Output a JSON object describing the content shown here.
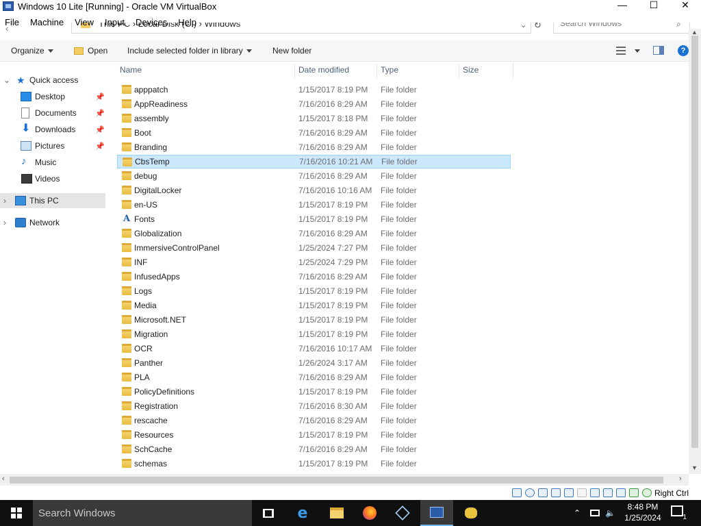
{
  "host_window": {
    "title": "Windows 10 Lite [Running] - Oracle VM VirtualBox",
    "minimize_glyph": "—",
    "maximize_glyph": "☐",
    "close_glyph": "✕"
  },
  "vbox_menu": [
    "File",
    "Machine",
    "View",
    "Input",
    "Devices",
    "Help"
  ],
  "address_bar": {
    "crumbs": "This PC  ›  Local Disk (C:)  ›  Windows",
    "search_placeholder": "Search Windows"
  },
  "toolbar": {
    "organize": "Organize",
    "open": "Open",
    "include_in_library": "Include selected folder in library",
    "new_folder": "New folder",
    "help_glyph": "?"
  },
  "nav": {
    "quick_access": "Quick access",
    "quick_items": [
      "Desktop",
      "Documents",
      "Downloads",
      "Pictures",
      "Music",
      "Videos"
    ],
    "this_pc": "This PC",
    "network": "Network"
  },
  "columns": [
    "Name",
    "Date modified",
    "Type",
    "Size"
  ],
  "files": [
    {
      "name": "apppatch",
      "date": "1/15/2017 8:19 PM",
      "type": "File folder",
      "icon": "folder-icon"
    },
    {
      "name": "AppReadiness",
      "date": "7/16/2016 8:29 AM",
      "type": "File folder",
      "icon": "folder-icon"
    },
    {
      "name": "assembly",
      "date": "1/15/2017 8:18 PM",
      "type": "File folder",
      "icon": "folder-icon"
    },
    {
      "name": "Boot",
      "date": "7/16/2016 8:29 AM",
      "type": "File folder",
      "icon": "folder-icon"
    },
    {
      "name": "Branding",
      "date": "7/16/2016 8:29 AM",
      "type": "File folder",
      "icon": "folder-icon"
    },
    {
      "name": "CbsTemp",
      "date": "7/16/2016 10:21 AM",
      "type": "File folder",
      "icon": "folder-icon",
      "selected": true
    },
    {
      "name": "debug",
      "date": "7/16/2016 8:29 AM",
      "type": "File folder",
      "icon": "folder-icon"
    },
    {
      "name": "DigitalLocker",
      "date": "7/16/2016 10:16 AM",
      "type": "File folder",
      "icon": "folder-icon"
    },
    {
      "name": "en-US",
      "date": "1/15/2017 8:19 PM",
      "type": "File folder",
      "icon": "folder-icon"
    },
    {
      "name": "Fonts",
      "date": "1/15/2017 8:19 PM",
      "type": "File folder",
      "icon": "font-folder-icon"
    },
    {
      "name": "Globalization",
      "date": "7/16/2016 8:29 AM",
      "type": "File folder",
      "icon": "folder-icon"
    },
    {
      "name": "ImmersiveControlPanel",
      "date": "1/25/2024 7:27 PM",
      "type": "File folder",
      "icon": "folder-icon"
    },
    {
      "name": "INF",
      "date": "1/25/2024 7:29 PM",
      "type": "File folder",
      "icon": "folder-icon"
    },
    {
      "name": "InfusedApps",
      "date": "7/16/2016 8:29 AM",
      "type": "File folder",
      "icon": "folder-icon"
    },
    {
      "name": "Logs",
      "date": "1/15/2017 8:19 PM",
      "type": "File folder",
      "icon": "folder-icon"
    },
    {
      "name": "Media",
      "date": "1/15/2017 8:19 PM",
      "type": "File folder",
      "icon": "folder-icon"
    },
    {
      "name": "Microsoft.NET",
      "date": "1/15/2017 8:19 PM",
      "type": "File folder",
      "icon": "folder-icon"
    },
    {
      "name": "Migration",
      "date": "1/15/2017 8:19 PM",
      "type": "File folder",
      "icon": "folder-icon"
    },
    {
      "name": "OCR",
      "date": "7/16/2016 10:17 AM",
      "type": "File folder",
      "icon": "folder-icon"
    },
    {
      "name": "Panther",
      "date": "1/26/2024 3:17 AM",
      "type": "File folder",
      "icon": "folder-icon"
    },
    {
      "name": "PLA",
      "date": "7/16/2016 8:29 AM",
      "type": "File folder",
      "icon": "folder-icon"
    },
    {
      "name": "PolicyDefinitions",
      "date": "1/15/2017 8:19 PM",
      "type": "File folder",
      "icon": "folder-icon"
    },
    {
      "name": "Registration",
      "date": "7/16/2016 8:30 AM",
      "type": "File folder",
      "icon": "folder-icon"
    },
    {
      "name": "rescache",
      "date": "7/16/2016 8:29 AM",
      "type": "File folder",
      "icon": "folder-icon"
    },
    {
      "name": "Resources",
      "date": "1/15/2017 8:19 PM",
      "type": "File folder",
      "icon": "folder-icon"
    },
    {
      "name": "SchCache",
      "date": "7/16/2016 8:29 AM",
      "type": "File folder",
      "icon": "folder-icon"
    },
    {
      "name": "schemas",
      "date": "1/15/2017 8:19 PM",
      "type": "File folder",
      "icon": "folder-icon"
    }
  ],
  "vbox_status": {
    "host_key": "Right Ctrl"
  },
  "taskbar": {
    "search_placeholder": "Search Windows",
    "time": "8:48 PM",
    "date": "1/25/2024",
    "notification_count": "1"
  },
  "colors": {
    "selection_bg": "#cce8ff",
    "selection_border": "#99d1ff",
    "nav_selected": "#e5e5e5",
    "taskbar": "#101010",
    "accent": "#76b9ed"
  }
}
